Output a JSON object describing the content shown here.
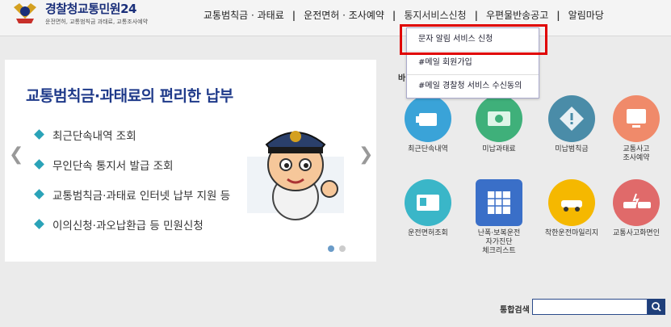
{
  "header": {
    "logo_title_a": "경찰청",
    "logo_title_b": "교통민원24",
    "logo_subtitle": "운전면허, 교통범칙금 과태료, 교통조사예약"
  },
  "nav": [
    {
      "label": "교통범칙금 · 과태료"
    },
    {
      "label": "운전면허 · 조사예약"
    },
    {
      "label": "통지서비스신청"
    },
    {
      "label": "우편물반송공고"
    },
    {
      "label": "알림마당"
    }
  ],
  "nav_separator": "|",
  "dropdown": [
    {
      "label": "문자 알림 서비스 신청"
    },
    {
      "label": "#메일 회원가입"
    },
    {
      "label": "#메일 경찰청 서비스 수신동의"
    }
  ],
  "banner": {
    "title": "교통범칙금·과태료의 편리한 납부",
    "bullets": [
      "최근단속내역 조회",
      "무인단속 통지서 발급 조회",
      "교통범칙금·과태료 인터넷 납부 지원 등",
      "이의신청·과오납환급 등 민원신청"
    ],
    "prev": "❮",
    "next": "❯"
  },
  "quick_label": "바",
  "icons": [
    {
      "label": "최근단속내역",
      "color": "#3aa3d8"
    },
    {
      "label": "미납과태료",
      "color": "#3fb07a"
    },
    {
      "label": "미납범칙금",
      "color": "#4a8ca8"
    },
    {
      "label": "교통사고\n조사예약",
      "color": "#f08a6a"
    },
    {
      "label": "운전면허조회",
      "color": "#3ab6c8"
    },
    {
      "label": "난폭·보복운전\n자가진단\n체크리스트",
      "color": "#3a6fc8"
    },
    {
      "label": "착한운전마일리지",
      "color": "#f5b800"
    },
    {
      "label": "교통사고화면인",
      "color": "#e06a6a"
    }
  ],
  "search": {
    "label": "통합검색",
    "placeholder": ""
  }
}
